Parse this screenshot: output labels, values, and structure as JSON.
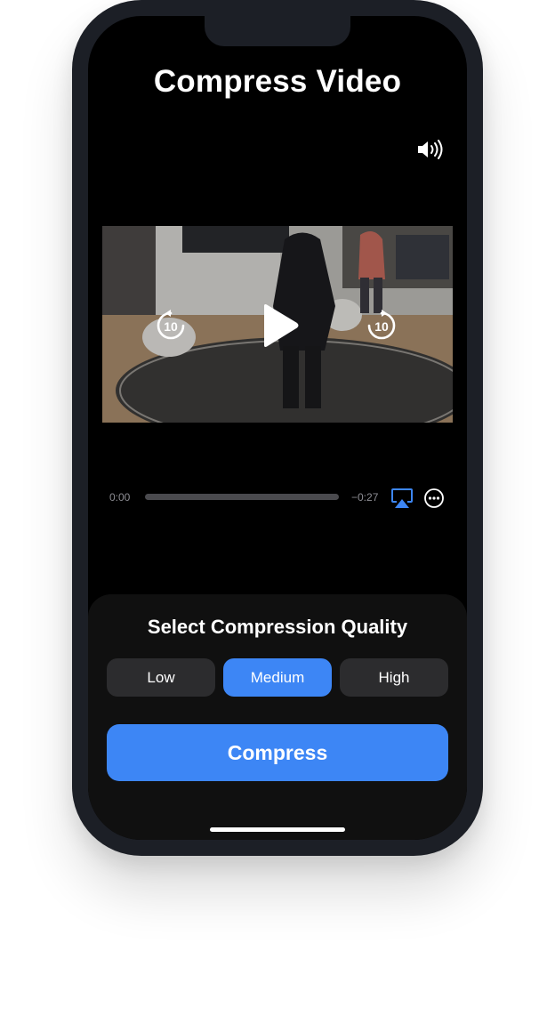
{
  "app": {
    "title": "Compress Video"
  },
  "player": {
    "volume_icon": "speaker-wave-icon",
    "skip_back_icon": "skip-back-10-icon",
    "play_icon": "play-icon",
    "skip_forward_icon": "skip-forward-10-icon",
    "skip_back_label": "10",
    "skip_forward_label": "10",
    "elapsed": "0:00",
    "remaining": "−0:27",
    "progress": 0,
    "airplay_icon": "airplay-icon",
    "more_icon": "ellipsis-circle-icon",
    "airplay_color": "#3d86f5"
  },
  "quality": {
    "title": "Select Compression Quality",
    "options": [
      "Low",
      "Medium",
      "High"
    ],
    "selected": "Medium",
    "accent": "#3d86f5"
  },
  "actions": {
    "compress_label": "Compress"
  }
}
